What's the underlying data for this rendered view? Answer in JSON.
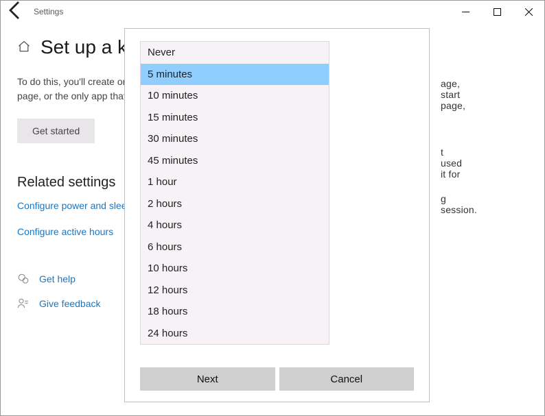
{
  "titlebar": {
    "title": "Settings"
  },
  "page": {
    "heading": "Set up a kiosk",
    "body": "To do this, you'll create or choose an account and then choose a home page, start page, or the only app that it can use (though you'll still have access to …",
    "get_started": "Get started",
    "related_heading": "Related settings",
    "link_power": "Configure power and sleep settings",
    "link_active": "Configure active hours",
    "help": "Get help",
    "feedback": "Give feedback"
  },
  "dialog": {
    "options": [
      "Never",
      "5 minutes",
      "10 minutes",
      "15 minutes",
      "30 minutes",
      "45 minutes",
      "1 hour",
      "2 hours",
      "4 hours",
      "6 hours",
      "10 hours",
      "12 hours",
      "18 hours",
      "24 hours"
    ],
    "selected_index": 1,
    "bg_fragment_1": "age, start page,",
    "bg_fragment_2": "t used it for",
    "bg_fragment_3": "g session.",
    "next": "Next",
    "cancel": "Cancel"
  }
}
